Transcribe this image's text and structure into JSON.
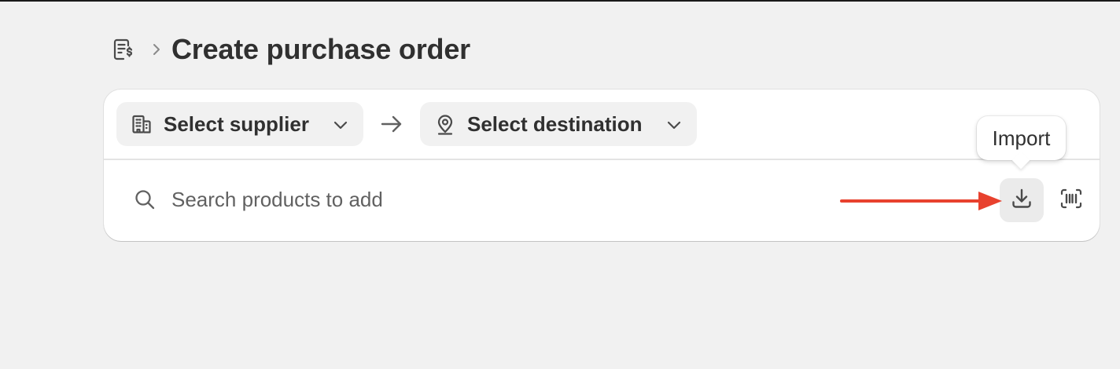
{
  "header": {
    "title": "Create purchase order",
    "icon": "purchase-order-icon",
    "separator_icon": "chevron-right-icon"
  },
  "toolbar": {
    "supplier_label": "Select supplier",
    "supplier_icon": "building-icon",
    "destination_label": "Select destination",
    "destination_icon": "location-pin-icon",
    "flow_icon": "arrow-right-icon"
  },
  "search": {
    "placeholder": "Search products to add",
    "value": ""
  },
  "actions": {
    "import_icon": "import-icon",
    "barcode_icon": "barcode-scan-icon",
    "tooltip": "Import"
  },
  "colors": {
    "background": "#f1f1f1",
    "card": "#ffffff",
    "pill": "#f1f1f1",
    "text": "#303030",
    "annotation_arrow": "#e8412e"
  }
}
